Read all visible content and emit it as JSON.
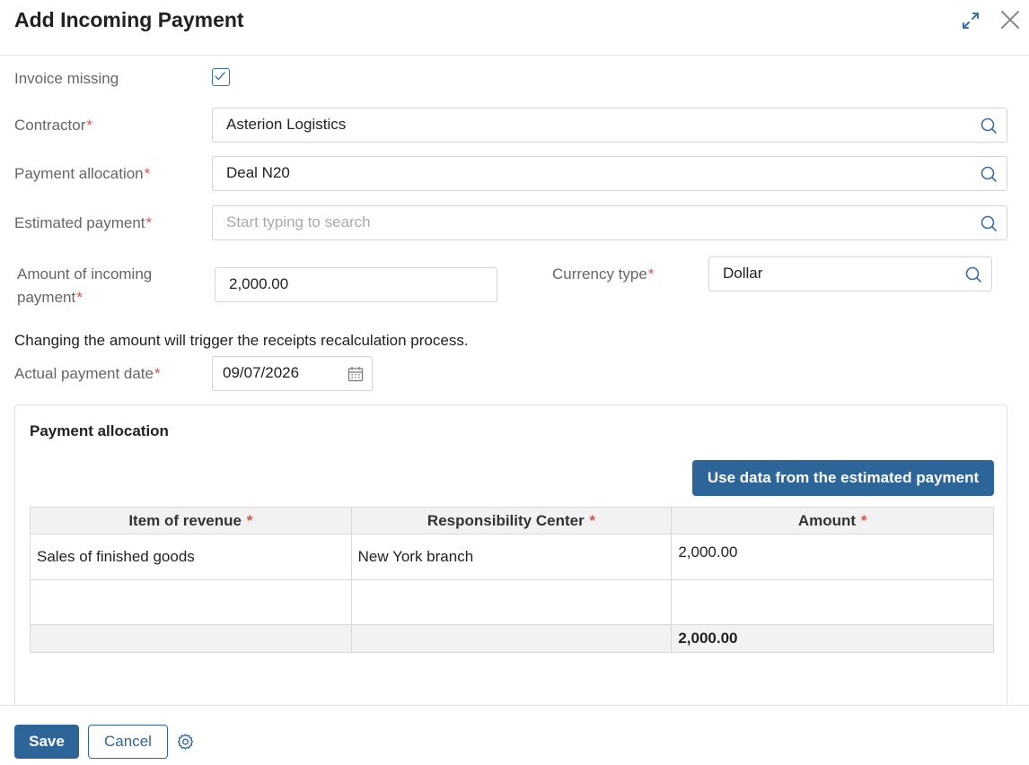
{
  "dialog": {
    "title": "Add Incoming Payment",
    "icons": {
      "expand": "expand-icon",
      "close": "close-icon"
    }
  },
  "form": {
    "invoice_missing": {
      "label": "Invoice missing",
      "checked": true
    },
    "contractor": {
      "label": "Contractor",
      "value": "Asterion Logistics"
    },
    "payment_allocation": {
      "label": "Payment allocation",
      "value": "Deal N20"
    },
    "estimated_payment": {
      "label": "Estimated payment",
      "placeholder": "Start typing to search"
    },
    "amount": {
      "label_line1": "Amount of incoming",
      "label_line2": "payment",
      "value": "2,000.00"
    },
    "currency": {
      "label": "Currency type",
      "value": "Dollar"
    },
    "note": "Changing the amount will trigger the receipts recalculation process.",
    "payment_date": {
      "label": "Actual payment date",
      "value": "09/07/2026"
    },
    "required_mark": "*"
  },
  "allocation": {
    "title": "Payment allocation",
    "use_data_button": "Use data from the estimated payment",
    "columns": [
      "Item of revenue",
      "Responsibility Center",
      "Amount"
    ],
    "rows": [
      {
        "item": "Sales of finished goods",
        "center": "New York branch",
        "amount": "2,000.00"
      },
      {
        "item": "",
        "center": "",
        "amount": ""
      }
    ],
    "total": "2,000.00"
  },
  "footer": {
    "save": "Save",
    "cancel": "Cancel",
    "settings_icon": "gear-icon"
  },
  "colors": {
    "accent": "#2e6599",
    "required": "#d9534f"
  }
}
